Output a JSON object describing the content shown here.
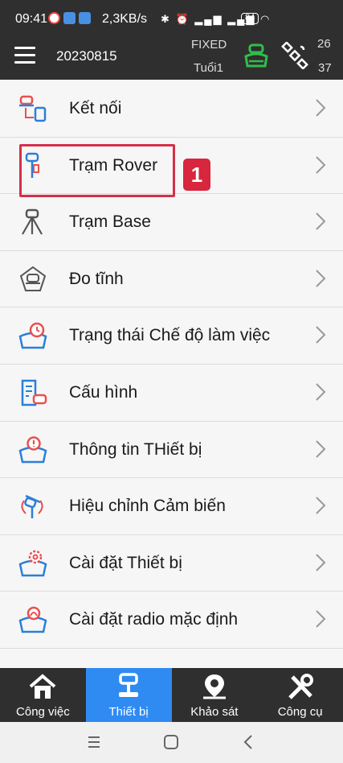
{
  "status_bar": {
    "time": "09:41",
    "speed": "2,3KB/s",
    "battery": "84"
  },
  "header": {
    "project_name": "20230815",
    "fix_status": "FIXED",
    "age_label": "Tuổi1",
    "sat_top": "26",
    "sat_bottom": "37"
  },
  "menu": {
    "items": [
      {
        "label": "Kết nối",
        "icon": "connection-icon"
      },
      {
        "label": "Trạm Rover",
        "icon": "rover-icon"
      },
      {
        "label": "Trạm Base",
        "icon": "base-station-icon"
      },
      {
        "label": "Đo tĩnh",
        "icon": "static-survey-icon"
      },
      {
        "label": "Trạng thái Chế độ làm việc",
        "icon": "work-mode-icon"
      },
      {
        "label": "Cấu hình",
        "icon": "configuration-icon"
      },
      {
        "label": "Thông tin THiết bị",
        "icon": "device-info-icon"
      },
      {
        "label": "Hiệu chỉnh Cảm biến",
        "icon": "sensor-calibration-icon"
      },
      {
        "label": "Cài đặt Thiết bị",
        "icon": "device-settings-icon"
      },
      {
        "label": "Cài đặt radio mặc định",
        "icon": "radio-settings-icon"
      }
    ]
  },
  "annotation": {
    "number": "1",
    "color": "#d7263d"
  },
  "bottom_nav": {
    "tabs": [
      {
        "label": "Công việc",
        "icon": "home-icon"
      },
      {
        "label": "Thiết bị",
        "icon": "device-icon",
        "active": true
      },
      {
        "label": "Khảo sát",
        "icon": "survey-pin-icon"
      },
      {
        "label": "Công cụ",
        "icon": "tools-icon"
      }
    ]
  },
  "colors": {
    "accent": "#2f8bf2",
    "bar": "#2f2f2f",
    "icon_red": "#e8504f",
    "icon_blue": "#2b7fd8",
    "gnss_green": "#2fbf4a"
  }
}
